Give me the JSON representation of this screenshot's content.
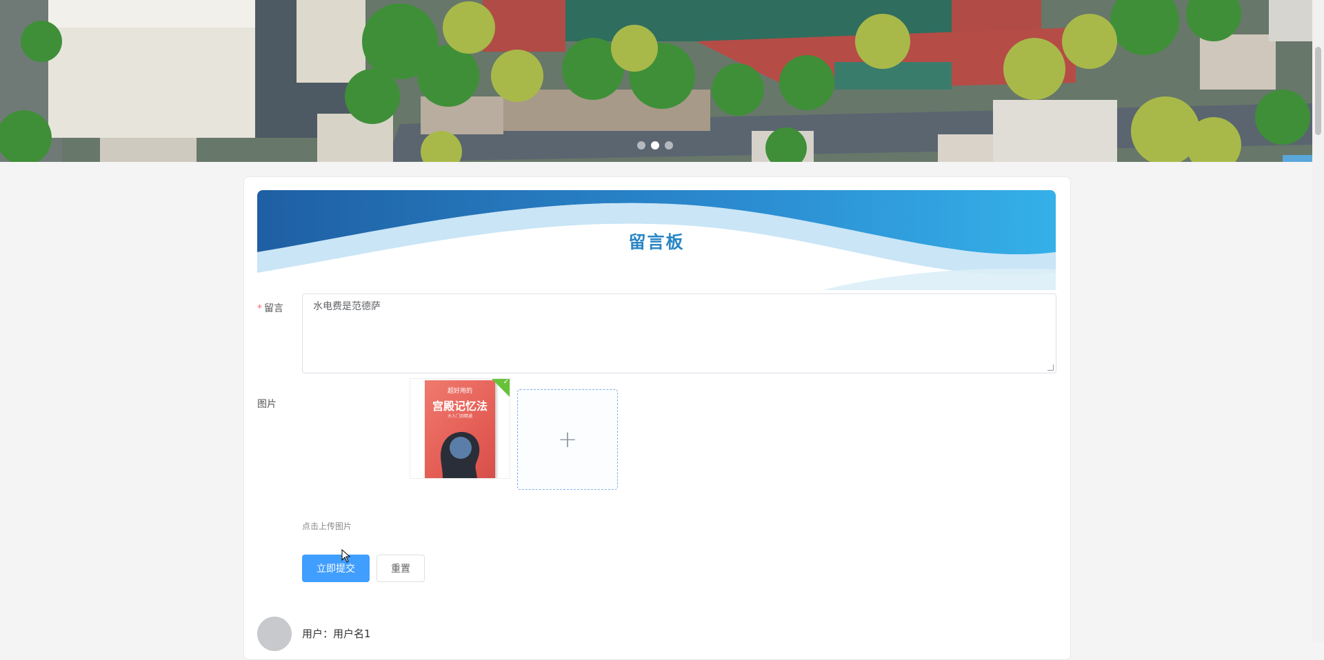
{
  "carousel": {
    "slide_count": 3,
    "active_index": 1
  },
  "board": {
    "title": "留言板"
  },
  "form": {
    "message_label": "留言",
    "required_mark": "*",
    "message_value": "水电费是范德萨",
    "image_label": "图片",
    "upload_hint": "点击上传图片",
    "uploaded_book": {
      "sub": "超好用的",
      "title": "宫殿记忆法",
      "small": "大人门到精通"
    },
    "submit_label": "立即提交",
    "reset_label": "重置"
  },
  "comments": [
    {
      "user_line": "用户：用户名1"
    }
  ],
  "colors": {
    "accent": "#409eff",
    "title": "#2a86c5",
    "required": "#f56c6c",
    "upload_success": "#67c23a"
  },
  "icons": {
    "upload": "plus-icon",
    "uploaded": "check-icon"
  }
}
